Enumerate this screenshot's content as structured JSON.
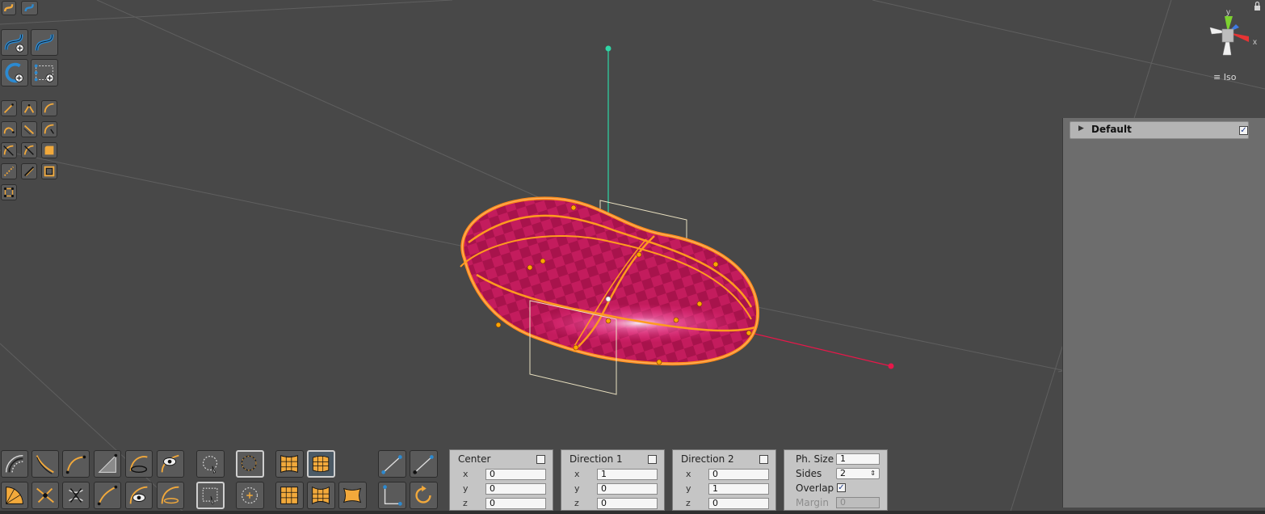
{
  "scene_gizmo": {
    "projection_label": "Iso",
    "axis_labels": {
      "x": "x",
      "y": "y"
    }
  },
  "layers_panel": {
    "items": [
      {
        "label": "Default",
        "enabled": true
      }
    ]
  },
  "center_panel": {
    "title": "Center",
    "checked": false,
    "fields": [
      {
        "axis": "x",
        "value": "0"
      },
      {
        "axis": "y",
        "value": "0"
      },
      {
        "axis": "z",
        "value": "0"
      }
    ]
  },
  "direction1_panel": {
    "title": "Direction 1",
    "checked": false,
    "fields": [
      {
        "axis": "x",
        "value": "1"
      },
      {
        "axis": "y",
        "value": "0"
      },
      {
        "axis": "z",
        "value": "0"
      }
    ]
  },
  "direction2_panel": {
    "title": "Direction 2",
    "checked": false,
    "fields": [
      {
        "axis": "x",
        "value": "0"
      },
      {
        "axis": "y",
        "value": "1"
      },
      {
        "axis": "z",
        "value": "0"
      }
    ]
  },
  "settings_panel": {
    "ph_size": {
      "label": "Ph. Size",
      "value": "1"
    },
    "sides": {
      "label": "Sides",
      "value": "2"
    },
    "overlap": {
      "label": "Overlap",
      "checked": true
    },
    "margin": {
      "label": "Margin",
      "value": "0",
      "disabled": true
    }
  },
  "colors": {
    "viewport_bg": "#484848",
    "surface_fill": "#c01a5a",
    "curve_orange": "#ff9a1f",
    "axis_green": "#2fd6a6",
    "axis_red": "#e8174a",
    "panel_bg": "#c5c5c5"
  },
  "icons": {
    "left_toolbar": [
      "curve-small-icon",
      "curve-blue-small-icon",
      "curve-add-icon",
      "curve-blue-icon",
      "circle-add-icon",
      "group-add-icon",
      "line-tool-icon",
      "arc-tool-icon",
      "bezier-tool-icon",
      "blend-tool-icon",
      "offset-tool-icon",
      "fillet-tool-icon",
      "trim-tool-icon",
      "split-tool-icon",
      "patch-tool-icon",
      "dotted-line-icon",
      "knife-tool-icon",
      "frame-tool-icon",
      "snap-grid-icon"
    ],
    "bottom_toolbar": [
      "rings-icon",
      "sweep-icon",
      "arc-points-icon",
      "loft-icon",
      "revolve-icon",
      "eye-curve-icon",
      "lasso-select-icon",
      "circle-select-icon",
      "surface-grid-icon",
      "surface-grid-blue-icon",
      "fan-surface-icon",
      "move-points-icon",
      "intersect-icon",
      "project-icon",
      "eye-surface-icon",
      "surface-edit-icon",
      "rect-select-icon",
      "dotted-circle-icon",
      "grid-tile-icon",
      "grid-curved-icon",
      "patch-surface-icon",
      "line-segment-icon",
      "line-node-icon",
      "corner-icon",
      "rotate-icon"
    ]
  }
}
